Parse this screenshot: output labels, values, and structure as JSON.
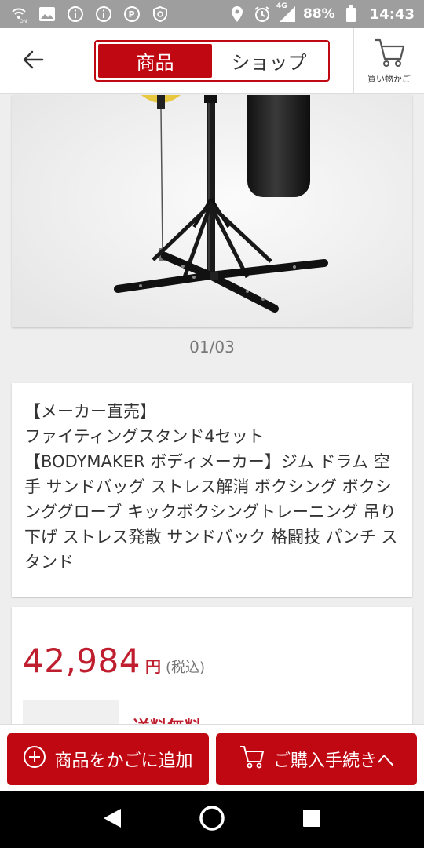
{
  "status_bar": {
    "battery_pct": "88%",
    "network": "4G",
    "time": "14:43"
  },
  "header": {
    "tabs": [
      {
        "label": "商品",
        "active": true
      },
      {
        "label": "ショップ",
        "active": false
      }
    ],
    "cart_label": "買い物かご"
  },
  "gallery": {
    "pager": "01/03"
  },
  "product": {
    "title": "【メーカー直売】\nファイティングスタンド4セット\n【BODYMAKER ボディメーカー】ジム ドラム 空手 サンドバッグ ストレス解消 ボクシング ボクシンググローブ キックボクシングトレーニング 吊り下げ ストレス発散 サンドバック 格闘技 パンチ スタンド"
  },
  "price": {
    "value": "42,984",
    "currency": "円",
    "tax": "(税込)",
    "shipping": "送料無料"
  },
  "actions": {
    "add_to_cart": "商品をかごに追加",
    "checkout": "ご購入手続きへ"
  },
  "colors": {
    "brand_red": "#c00812",
    "price_red": "#bf1e2e"
  },
  "icons": {
    "back": "arrow-left-icon",
    "cart": "cart-icon",
    "add": "plus-circle-icon"
  }
}
